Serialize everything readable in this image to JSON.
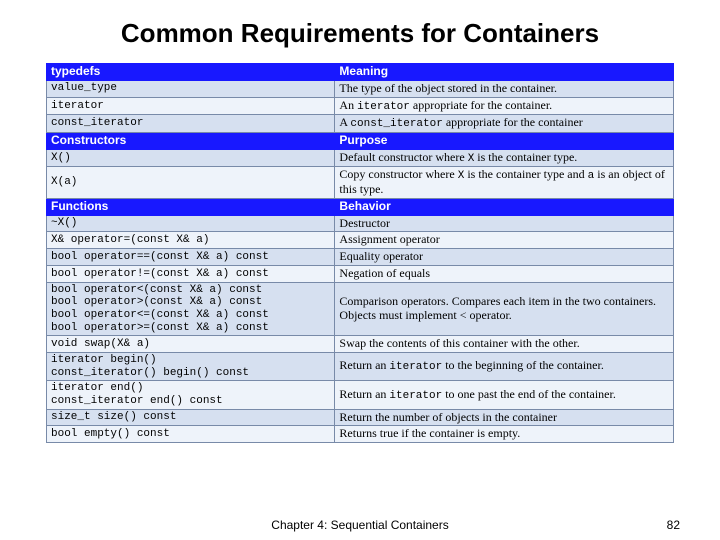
{
  "title": "Common Requirements for Containers",
  "sections": [
    {
      "header": {
        "left": "typedefs",
        "right": "Meaning"
      },
      "rows": [
        {
          "code": "value_type",
          "meaning": "The type of the object stored in the container."
        },
        {
          "code": "iterator",
          "meaning_parts": [
            "An ",
            {
              "mono": "iterator"
            },
            " appropriate for the container."
          ]
        },
        {
          "code": "const_iterator",
          "meaning_parts": [
            "A ",
            {
              "mono": "const_iterator"
            },
            " appropriate for the container"
          ]
        }
      ]
    },
    {
      "header": {
        "left": "Constructors",
        "right": "Purpose"
      },
      "rows": [
        {
          "code": "X()",
          "meaning_parts": [
            "Default constructor where ",
            {
              "mono": "X"
            },
            " is the container type."
          ]
        },
        {
          "code": "X(a)",
          "meaning_parts": [
            "Copy constructor where ",
            {
              "mono": "X"
            },
            " is the container type and ",
            {
              "mono": "a"
            },
            " is an object of this type."
          ]
        }
      ]
    },
    {
      "header": {
        "left": "Functions",
        "right": "Behavior"
      },
      "rows": [
        {
          "code": "~X()",
          "meaning": "Destructor"
        },
        {
          "code": "X& operator=(const X& a)",
          "meaning": "Assignment operator"
        },
        {
          "code": "bool operator==(const X& a) const",
          "meaning": "Equality operator"
        },
        {
          "code": "bool operator!=(const X& a) const",
          "meaning": "Negation of equals"
        },
        {
          "code": "bool operator<(const X& a) const\nbool operator>(const X& a) const\nbool operator<=(const X& a) const\nbool operator>=(const X& a) const",
          "meaning": "Comparison operators. Compares each item in the two containers. Objects must implement < operator."
        },
        {
          "code": "void swap(X& a)",
          "meaning": "Swap the contents of this container with the other."
        },
        {
          "code": "iterator begin()\nconst_iterator() begin() const",
          "meaning_parts": [
            "Return an ",
            {
              "mono": "iterator"
            },
            " to the beginning of the container."
          ]
        },
        {
          "code": "iterator end()\nconst_iterator end() const",
          "meaning_parts": [
            "Return an ",
            {
              "mono": "iterator"
            },
            " to one past the end of the container."
          ]
        },
        {
          "code": "size_t size() const",
          "meaning": "Return the number of objects in the container"
        },
        {
          "code": "bool empty() const",
          "meaning": "Returns true if the container is empty."
        }
      ]
    }
  ],
  "footer": {
    "center": "Chapter 4: Sequential Containers",
    "page": "82"
  }
}
